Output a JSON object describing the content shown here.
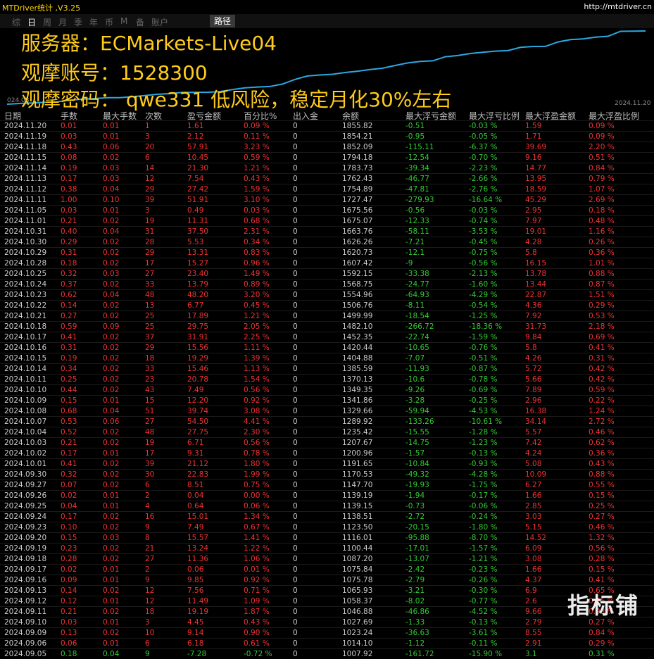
{
  "app": {
    "title": "MTDriver统计 ,V3.25",
    "url": "http://mtdriver.cn"
  },
  "tabs": [
    "综",
    "日",
    "周",
    "月",
    "季",
    "年",
    "币",
    "M",
    "备",
    "账户"
  ],
  "active_tab": "日",
  "route_tab": "路径",
  "overlay": {
    "server": "服务器：ECMarkets-Live04",
    "account": "观摩账号：1528300",
    "password": "观摩密码： qwe331  低风险，稳定月化30%左右"
  },
  "chart_axis": {
    "left_label": "024.08",
    "right_label": "2024.11.20"
  },
  "colors": {
    "line": "#2aa8e0",
    "profit": "#e33333",
    "loss": "#33cc33",
    "overlay": "#ffcc1a"
  },
  "columns": [
    "日期",
    "手数",
    "最大手数",
    "次数",
    "盈亏金额",
    "百分比%",
    "出入金",
    "余额",
    "最大浮亏金额",
    "最大浮亏比例",
    "最大浮盈金额",
    "最大浮盈比例"
  ],
  "rows": [
    [
      "2024.11.20",
      "0.01",
      "0.01",
      "1",
      "1.61",
      "0.09 %",
      "0",
      "1855.82",
      "-0.51",
      "-0.03 %",
      "1.59",
      "0.09 %"
    ],
    [
      "2024.11.19",
      "0.03",
      "0.01",
      "3",
      "2.12",
      "0.11 %",
      "0",
      "1854.21",
      "-0.95",
      "-0.05 %",
      "1.71",
      "0.09 %"
    ],
    [
      "2024.11.18",
      "0.43",
      "0.06",
      "20",
      "57.91",
      "3.23 %",
      "0",
      "1852.09",
      "-115.11",
      "-6.37 %",
      "39.69",
      "2.20 %"
    ],
    [
      "2024.11.15",
      "0.08",
      "0.02",
      "6",
      "10.45",
      "0.59 %",
      "0",
      "1794.18",
      "-12.54",
      "-0.70 %",
      "9.16",
      "0.51 %"
    ],
    [
      "2024.11.14",
      "0.19",
      "0.03",
      "14",
      "21.30",
      "1.21 %",
      "0",
      "1783.73",
      "-39.34",
      "-2.23 %",
      "14.77",
      "0.84 %"
    ],
    [
      "2024.11.13",
      "0.17",
      "0.03",
      "12",
      "7.54",
      "0.43 %",
      "0",
      "1762.43",
      "-46.77",
      "-2.66 %",
      "13.95",
      "0.79 %"
    ],
    [
      "2024.11.12",
      "0.38",
      "0.04",
      "29",
      "27.42",
      "1.59 %",
      "0",
      "1754.89",
      "-47.81",
      "-2.76 %",
      "18.59",
      "1.07 %"
    ],
    [
      "2024.11.11",
      "1.00",
      "0.10",
      "39",
      "51.91",
      "3.10 %",
      "0",
      "1727.47",
      "-279.93",
      "-16.64 %",
      "45.29",
      "2.69 %"
    ],
    [
      "2024.11.05",
      "0.03",
      "0.01",
      "3",
      "0.49",
      "0.03 %",
      "0",
      "1675.56",
      "-0.56",
      "-0.03 %",
      "2.95",
      "0.18 %"
    ],
    [
      "2024.11.01",
      "0.21",
      "0.02",
      "19",
      "11.31",
      "0.68 %",
      "0",
      "1675.07",
      "-12.33",
      "-0.74 %",
      "7.97",
      "0.48 %"
    ],
    [
      "2024.10.31",
      "0.40",
      "0.04",
      "31",
      "37.50",
      "2.31 %",
      "0",
      "1663.76",
      "-58.11",
      "-3.53 %",
      "19.01",
      "1.16 %"
    ],
    [
      "2024.10.30",
      "0.29",
      "0.02",
      "28",
      "5.53",
      "0.34 %",
      "0",
      "1626.26",
      "-7.21",
      "-0.45 %",
      "4.28",
      "0.26 %"
    ],
    [
      "2024.10.29",
      "0.31",
      "0.02",
      "29",
      "13.31",
      "0.83 %",
      "0",
      "1620.73",
      "-12.1",
      "-0.75 %",
      "5.8",
      "0.36 %"
    ],
    [
      "2024.10.28",
      "0.18",
      "0.02",
      "17",
      "15.27",
      "0.96 %",
      "0",
      "1607.42",
      "-9",
      "-0.56 %",
      "16.15",
      "1.01 %"
    ],
    [
      "2024.10.25",
      "0.32",
      "0.03",
      "27",
      "23.40",
      "1.49 %",
      "0",
      "1592.15",
      "-33.38",
      "-2.13 %",
      "13.78",
      "0.88 %"
    ],
    [
      "2024.10.24",
      "0.37",
      "0.02",
      "33",
      "13.79",
      "0.89 %",
      "0",
      "1568.75",
      "-24.77",
      "-1.60 %",
      "13.44",
      "0.87 %"
    ],
    [
      "2024.10.23",
      "0.62",
      "0.04",
      "48",
      "48.20",
      "3.20 %",
      "0",
      "1554.96",
      "-64.93",
      "-4.29 %",
      "22.87",
      "1.51 %"
    ],
    [
      "2024.10.22",
      "0.14",
      "0.02",
      "13",
      "6.77",
      "0.45 %",
      "0",
      "1506.76",
      "-8.11",
      "-0.54 %",
      "4.36",
      "0.29 %"
    ],
    [
      "2024.10.21",
      "0.27",
      "0.02",
      "25",
      "17.89",
      "1.21 %",
      "0",
      "1499.99",
      "-18.54",
      "-1.25 %",
      "7.92",
      "0.53 %"
    ],
    [
      "2024.10.18",
      "0.59",
      "0.09",
      "25",
      "29.75",
      "2.05 %",
      "0",
      "1482.10",
      "-266.72",
      "-18.36 %",
      "31.73",
      "2.18 %"
    ],
    [
      "2024.10.17",
      "0.41",
      "0.02",
      "37",
      "31.91",
      "2.25 %",
      "0",
      "1452.35",
      "-22.74",
      "-1.59 %",
      "9.84",
      "0.69 %"
    ],
    [
      "2024.10.16",
      "0.31",
      "0.02",
      "29",
      "15.56",
      "1.11 %",
      "0",
      "1420.44",
      "-10.65",
      "-0.76 %",
      "5.8",
      "0.41 %"
    ],
    [
      "2024.10.15",
      "0.19",
      "0.02",
      "18",
      "19.29",
      "1.39 %",
      "0",
      "1404.88",
      "-7.07",
      "-0.51 %",
      "4.26",
      "0.31 %"
    ],
    [
      "2024.10.14",
      "0.34",
      "0.02",
      "33",
      "15.46",
      "1.13 %",
      "0",
      "1385.59",
      "-11.93",
      "-0.87 %",
      "5.72",
      "0.42 %"
    ],
    [
      "2024.10.11",
      "0.25",
      "0.02",
      "23",
      "20.78",
      "1.54 %",
      "0",
      "1370.13",
      "-10.6",
      "-0.78 %",
      "5.66",
      "0.42 %"
    ],
    [
      "2024.10.10",
      "0.44",
      "0.02",
      "43",
      "7.49",
      "0.56 %",
      "0",
      "1349.35",
      "-9.26",
      "-0.69 %",
      "7.89",
      "0.59 %"
    ],
    [
      "2024.10.09",
      "0.15",
      "0.01",
      "15",
      "12.20",
      "0.92 %",
      "0",
      "1341.86",
      "-3.28",
      "-0.25 %",
      "2.96",
      "0.22 %"
    ],
    [
      "2024.10.08",
      "0.68",
      "0.04",
      "51",
      "39.74",
      "3.08 %",
      "0",
      "1329.66",
      "-59.94",
      "-4.53 %",
      "16.38",
      "1.24 %"
    ],
    [
      "2024.10.07",
      "0.53",
      "0.06",
      "27",
      "54.50",
      "4.41 %",
      "0",
      "1289.92",
      "-133.26",
      "-10.61 %",
      "34.14",
      "2.72 %"
    ],
    [
      "2024.10.04",
      "0.52",
      "0.02",
      "48",
      "27.75",
      "2.30 %",
      "0",
      "1235.42",
      "-15.55",
      "-1.28 %",
      "5.57",
      "0.46 %"
    ],
    [
      "2024.10.03",
      "0.21",
      "0.02",
      "19",
      "6.71",
      "0.56 %",
      "0",
      "1207.67",
      "-14.75",
      "-1.23 %",
      "7.42",
      "0.62 %"
    ],
    [
      "2024.10.02",
      "0.17",
      "0.01",
      "17",
      "9.31",
      "0.78 %",
      "0",
      "1200.96",
      "-1.57",
      "-0.13 %",
      "4.24",
      "0.36 %"
    ],
    [
      "2024.10.01",
      "0.41",
      "0.02",
      "39",
      "21.12",
      "1.80 %",
      "0",
      "1191.65",
      "-10.84",
      "-0.93 %",
      "5.08",
      "0.43 %"
    ],
    [
      "2024.09.30",
      "0.32",
      "0.02",
      "30",
      "22.83",
      "1.99 %",
      "0",
      "1170.53",
      "-49.32",
      "-4.28 %",
      "10.09",
      "0.88 %"
    ],
    [
      "2024.09.27",
      "0.07",
      "0.02",
      "6",
      "8.51",
      "0.75 %",
      "0",
      "1147.70",
      "-19.93",
      "-1.75 %",
      "6.27",
      "0.55 %"
    ],
    [
      "2024.09.26",
      "0.02",
      "0.01",
      "2",
      "0.04",
      "0.00 %",
      "0",
      "1139.19",
      "-1.94",
      "-0.17 %",
      "1.66",
      "0.15 %"
    ],
    [
      "2024.09.25",
      "0.04",
      "0.01",
      "4",
      "0.64",
      "0.06 %",
      "0",
      "1139.15",
      "-0.73",
      "-0.06 %",
      "2.85",
      "0.25 %"
    ],
    [
      "2024.09.24",
      "0.17",
      "0.02",
      "16",
      "15.01",
      "1.34 %",
      "0",
      "1138.51",
      "-2.72",
      "-0.24 %",
      "3.03",
      "0.27 %"
    ],
    [
      "2024.09.23",
      "0.10",
      "0.02",
      "9",
      "7.49",
      "0.67 %",
      "0",
      "1123.50",
      "-20.15",
      "-1.80 %",
      "5.15",
      "0.46 %"
    ],
    [
      "2024.09.20",
      "0.15",
      "0.03",
      "8",
      "15.57",
      "1.41 %",
      "0",
      "1116.01",
      "-95.88",
      "-8.70 %",
      "14.52",
      "1.32 %"
    ],
    [
      "2024.09.19",
      "0.23",
      "0.02",
      "21",
      "13.24",
      "1.22 %",
      "0",
      "1100.44",
      "-17.01",
      "-1.57 %",
      "6.09",
      "0.56 %"
    ],
    [
      "2024.09.18",
      "0.28",
      "0.02",
      "27",
      "11.36",
      "1.06 %",
      "0",
      "1087.20",
      "-13.07",
      "-1.21 %",
      "3.08",
      "0.28 %"
    ],
    [
      "2024.09.17",
      "0.02",
      "0.01",
      "2",
      "0.06",
      "0.01 %",
      "0",
      "1075.84",
      "-2.42",
      "-0.23 %",
      "1.66",
      "0.15 %"
    ],
    [
      "2024.09.16",
      "0.09",
      "0.01",
      "9",
      "9.85",
      "0.92 %",
      "0",
      "1075.78",
      "-2.79",
      "-0.26 %",
      "4.37",
      "0.41 %"
    ],
    [
      "2024.09.13",
      "0.14",
      "0.02",
      "12",
      "7.56",
      "0.71 %",
      "0",
      "1065.93",
      "-3.21",
      "-0.30 %",
      "6.9",
      "0.65 %"
    ],
    [
      "2024.09.12",
      "0.12",
      "0.01",
      "12",
      "11.49",
      "1.09 %",
      "0",
      "1058.37",
      "-8.02",
      "-0.77 %",
      "2.6",
      "0.25 %"
    ],
    [
      "2024.09.11",
      "0.21",
      "0.02",
      "18",
      "19.19",
      "1.87 %",
      "0",
      "1046.88",
      "-46.86",
      "-4.52 %",
      "9.66",
      "0.93 %"
    ],
    [
      "2024.09.10",
      "0.03",
      "0.01",
      "3",
      "4.45",
      "0.43 %",
      "0",
      "1027.69",
      "-1.33",
      "-0.13 %",
      "2.79",
      "0.27 %"
    ],
    [
      "2024.09.09",
      "0.13",
      "0.02",
      "10",
      "9.14",
      "0.90 %",
      "0",
      "1023.24",
      "-36.63",
      "-3.61 %",
      "8.55",
      "0.84 %"
    ],
    [
      "2024.09.06",
      "0.06",
      "0.01",
      "6",
      "6.18",
      "0.61 %",
      "0",
      "1014.10",
      "-1.12",
      "-0.11 %",
      "2.91",
      "0.29 %"
    ],
    [
      "2024.09.05",
      "0.18",
      "0.04",
      "9",
      "-7.28",
      "-0.72 %",
      "0",
      "1007.92",
      "-161.72",
      "-15.90 %",
      "3.1",
      "0.31 %"
    ]
  ],
  "balance_series": [
    1000,
    1007.92,
    1014.1,
    1023.24,
    1027.69,
    1046.88,
    1058.37,
    1065.93,
    1075.78,
    1075.84,
    1087.2,
    1100.44,
    1116.01,
    1123.5,
    1138.51,
    1139.15,
    1139.19,
    1147.7,
    1170.53,
    1191.65,
    1200.96,
    1207.67,
    1235.42,
    1289.92,
    1329.66,
    1341.86,
    1349.35,
    1370.13,
    1385.59,
    1404.88,
    1420.44,
    1452.35,
    1482.1,
    1499.99,
    1506.76,
    1554.96,
    1568.75,
    1592.15,
    1607.42,
    1620.73,
    1626.26,
    1663.76,
    1675.07,
    1675.56,
    1727.47,
    1754.89,
    1762.43,
    1783.73,
    1794.18,
    1852.09,
    1854.21,
    1855.82
  ],
  "watermark": "指标铺"
}
